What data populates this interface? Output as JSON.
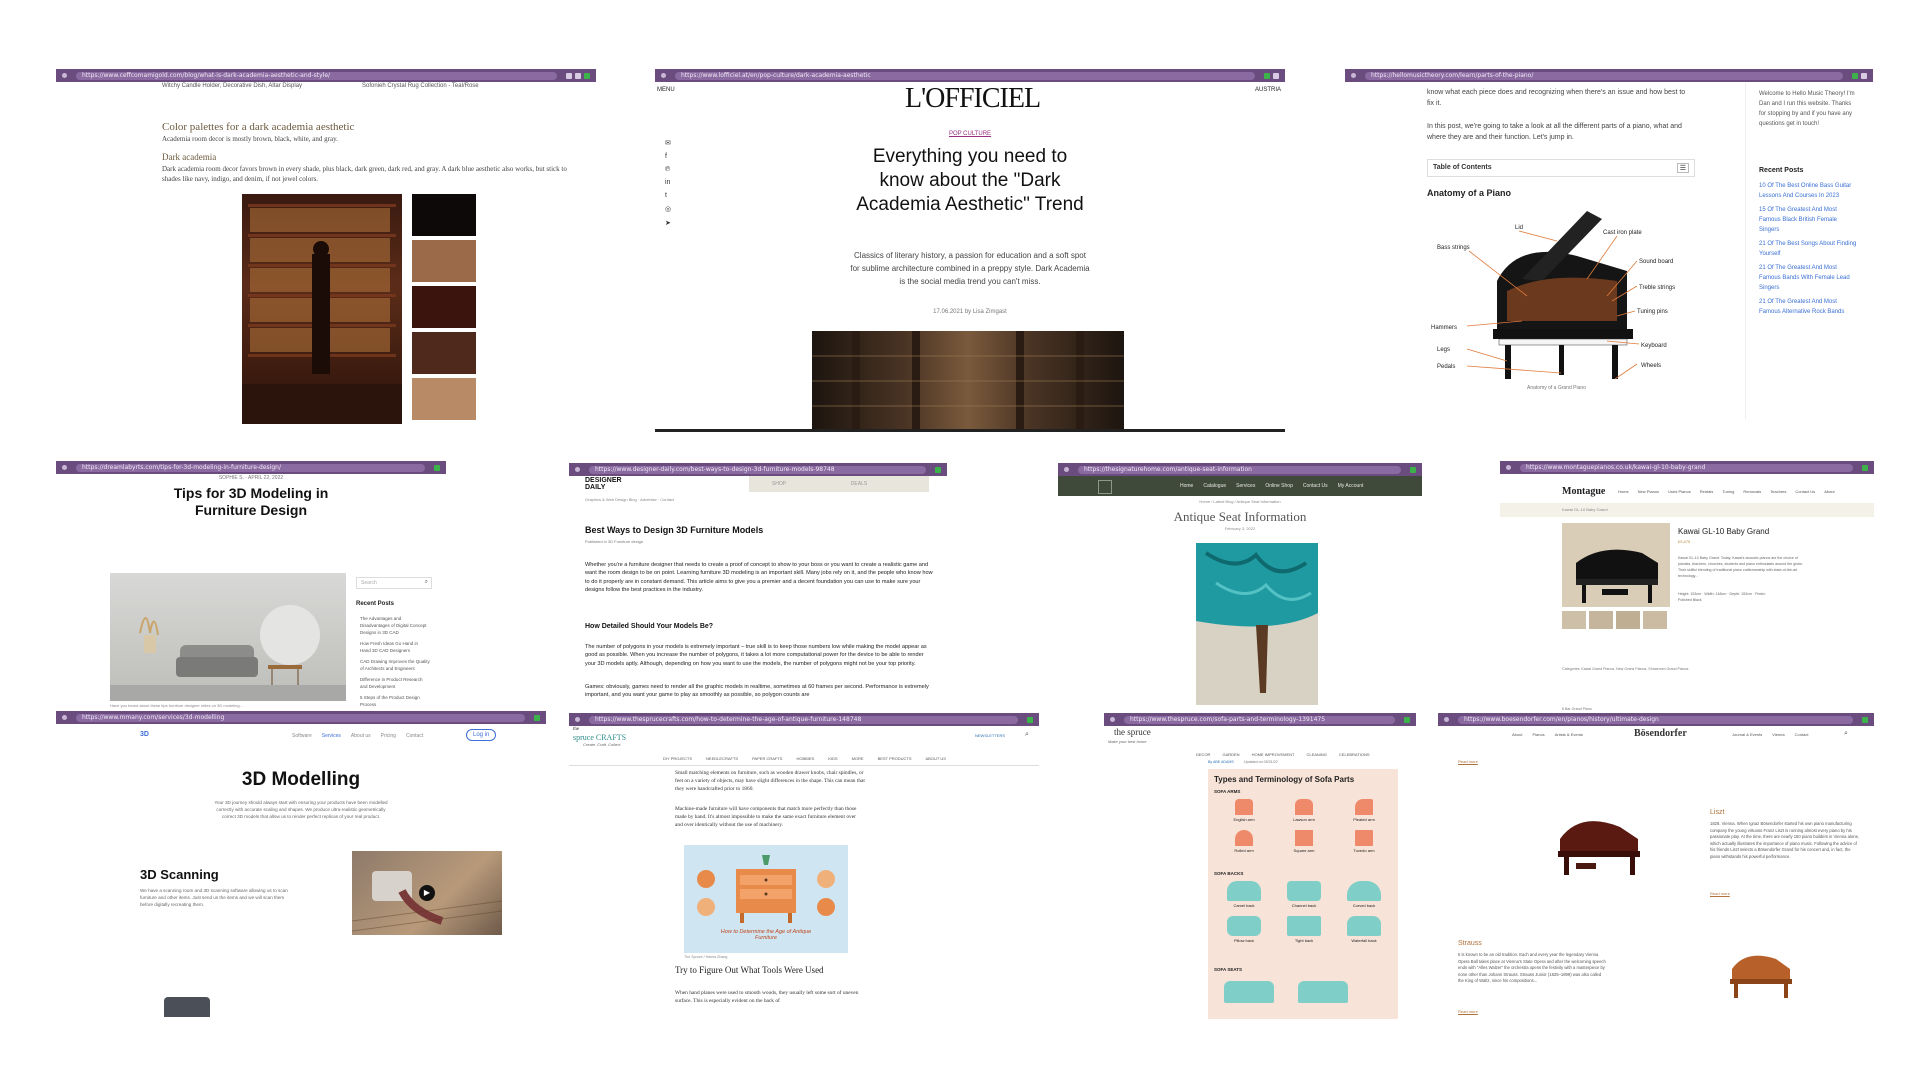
{
  "s1": {
    "url": "https://www.ceffcomamigold.com/blog/what-is-dark-academia-aesthetic-and-style/",
    "top_left": "Witchy Candle Holder, Decorative Dish, Altar Display",
    "top_right": "Sofonieh Crystal Rug Collection - Teal/Rose",
    "heading": "Color palettes for a dark academia aesthetic",
    "intro": "Academia room decor is mostly brown, black, white, and gray.",
    "subheading": "Dark academia",
    "body": "Dark academia room decor favors brown in every shade, plus black, dark green, dark red, and gray. A dark blue aesthetic also works, but stick to shades like navy, indigo, and denim, if not jewel colors.",
    "swatches": [
      "#0d0909",
      "#9b6a49",
      "#3b140d",
      "#4f2a1c",
      "#b88b66"
    ]
  },
  "s2": {
    "url": "https://www.lofficiel.at/en/pop-culture/dark-academia-aesthetic",
    "menu": "MENU",
    "logo": "L'OFFICIEL",
    "region": "AUSTRIA",
    "category": "POP CULTURE",
    "title": "Everything you need to know about the \"Dark Academia Aesthetic\" Trend",
    "dek": "Classics of literary history, a passion for education and a soft spot for sublime architecture combined in a preppy style. Dark Academia is the social media trend you can't miss.",
    "byline": "17.06.2021 by Lisa Zimgast"
  },
  "s3": {
    "url": "https://hellomusictheory.com/learn/parts-of-the-piano/",
    "p1": "know what each piece does and recognizing when there's an issue and how best to fix it.",
    "p2": "In this post, we're going to take a look at all the different parts of a piano, what and where they are and their function. Let's jump in.",
    "toc": "Table of Contents",
    "section": "Anatomy of a Piano",
    "labels": [
      "Lid",
      "Cast iron plate",
      "Bass strings",
      "Sound board",
      "Treble strings",
      "Tuning pins",
      "Hammers",
      "Keyboard",
      "Legs",
      "Pedals",
      "Wheels"
    ],
    "caption": "Anatomy of a Grand Piano",
    "sidebar_intro": "Welcome to Hello Music Theory! I'm Dan and I run this website. Thanks for stopping by and if you have any questions get in touch!",
    "recent_title": "Recent Posts",
    "recent": [
      "10 Of The Best Online Bass Guitar Lessons And Courses In 2023",
      "15 Of The Greatest And Most Famous Black British Female Singers",
      "21 Of The Best Songs About Finding Yourself",
      "21 Of The Greatest And Most Famous Bands With Female Lead Singers",
      "21 Of The Greatest And Most Famous Alternative Rock Bands"
    ]
  },
  "s4": {
    "url": "https://dreamlabyrts.com/tips-for-3d-modeling-in-furniture-design/",
    "meta": "SOPHIE S. · APRIL 22, 2022",
    "title": "Tips for 3D Modeling in Furniture Design",
    "search": "Search",
    "recent_title": "Recent Posts",
    "recent": [
      "The Advantages and Disadvantages of Digital Concept Designs in 3D CAD",
      "How Fresh Ideas Go Hand in Hand 3D CAD Designers",
      "CAD Drawing Improves the Quality of Architects and Engineers",
      "Difference in Product Research and Development",
      "5 Steps of the Product Design Process"
    ],
    "caption": "Have you heard about these tips furniture designer relies on 3D modeling..."
  },
  "s5": {
    "url": "https://www.designer-daily.com/best-ways-to-design-3d-furniture-models-98748",
    "logo_line1": "DESIGNER",
    "logo_line2": "DAILY",
    "tab1": "SHOP",
    "tab2": "DEALS",
    "crumbs": "Graphics & Web Design Blog · Advertise · Contact",
    "title": "Best Ways to Design 3D Furniture Models",
    "published": "Published in 3D Furniture design",
    "p1": "Whether you're a furniture designer that needs to create a proof of concept to show to your boss or you want to create a realistic game and want the room design to be on point. Learning furniture 3D modeling is an important skill. Many jobs rely on it, and the people who know how to do it properly are in constant demand. This article aims to give you a premier and a decent foundation you can use to make sure your designs follow the best practices in the industry.",
    "h2": "How Detailed Should Your Models Be?",
    "p2": "The number of polygons in your models is extremely important – true skill is to keep those numbers low while making the model appear as good as possible. When you increase the number of polygons, it takes a lot more computational power for the device to be able to render your 3D models aptly. Although, depending on how you want to use the models, the number of polygons might not be your top priority.",
    "p3": "Games: obviously, games need to render all the graphic models in realtime, sometimes at 60 frames per second. Performance is extremely important, and you want your game to play as smoothly as possible, so polygon counts are"
  },
  "s6": {
    "url": "https://thesignaturehome.com/antique-seat-information",
    "nav": [
      "Home",
      "Catalogue",
      "Services",
      "Online Shop",
      "Contact Us",
      "My Account"
    ],
    "crumbs": "Home / Latest Blog / Antique Seat Information",
    "title": "Antique Seat Information",
    "date": "February 3, 2022"
  },
  "s7": {
    "url": "https://www.montaguepianos.co.uk/kawai-gl-10-baby-grand",
    "logo": "Montague",
    "nav": [
      "Home",
      "New Pianos",
      "Used Pianos",
      "Rentals",
      "Tuning",
      "Removals",
      "Teachers",
      "Contact Us",
      "About"
    ],
    "crumbs": "Kawai GL-10 Baby Grand",
    "title": "Kawai GL-10 Baby Grand",
    "price": "£9,475",
    "text": "Kawai GL-10 Baby Grand. Today, Kawai's acoustic pianos are the choice of pianists, teachers, churches, students and piano enthusiasts around the globe. Their skillful blending of traditional piano craftsmanship with state-of-the-art technology...",
    "specs": "Height: 153cm · Width: 148cm · Depth: 153cm · Finish: Polished Black",
    "category": "Categories: Kawai Grand Pianos, New Grand Pianos, Showroom Grand Pianos",
    "caption": "6 Bar Grand Piano"
  },
  "s8": {
    "url": "https://www.mmany.com/services/3d-modelling",
    "brand": "3D",
    "nav": [
      "Software",
      "Services",
      "About us",
      "Pricing",
      "Contact"
    ],
    "login": "Log in",
    "title": "3D Modelling",
    "intro": "Your 3D journey should always start with ensuring your products have been modelled correctly with accurate scaling and shapes. We produce ultra-realistic geometrically correct 3D models that allow us to render perfect replicas of your real product.",
    "sub": "3D Scanning",
    "sub_text": "We have a scanning room and 3D scanning software allowing us to scan furniture and other items. Just send us the items and we will scan them before digitally recreating them."
  },
  "s9": {
    "url": "https://www.thesprucecrafts.com/how-to-determine-the-age-of-antique-furniture-148748",
    "logo_top": "the",
    "logo": "spruce CRAFTS",
    "tagline": "Create. Craft. Collect.",
    "newsletter": "NEWSLETTERS",
    "nav": [
      "DIY PROJECTS",
      "NEEDLECRAFTS",
      "PAPER CRAFTS",
      "HOBBIES",
      "KIDS",
      "MORE",
      "BEST PRODUCTS",
      "ABOUT US"
    ],
    "p1": "Small matching elements on furniture, such as wooden drawer knobs, chair spindles, or feet on a variety of objects, may have slight differences in the shape. This can mean that they were handcrafted prior to 1860.",
    "p2": "Machine-made furniture will have components that match more perfectly than those made by hand. It's almost impossible to make the same exact furniture element over and over identically without the use of machinery.",
    "infographic": "How to Determine the Age of Antique Furniture",
    "credit": "The Spruce / Hanna Zhang",
    "h2": "Try to Figure Out What Tools Were Used",
    "p3": "When hand planes were used to smooth woods, they usually left some sort of uneven surface. This is especially evident on the back of"
  },
  "s10": {
    "url": "https://www.thespruce.com/sofa-parts-and-terminology-1391475",
    "logo": "the spruce",
    "tagline": "Make your best home",
    "nav": [
      "DECOR",
      "GARDEN",
      "HOME IMPROVEMENT",
      "CLEANING",
      "CELEBRATIONS"
    ],
    "author": "By ABE ADAMS",
    "updated": "Updated on 05/31/22",
    "title": "Types and Terminology of Sofa Parts",
    "arms_title": "SOFA ARMS",
    "arms": [
      "English arm",
      "Lawson arm",
      "Pleated arm",
      "Rolled arm",
      "Square arm",
      "Tuxedo arm"
    ],
    "backs_title": "SOFA BACKS",
    "backs": [
      "Camel back",
      "Channel back",
      "Curved back",
      "Pillow back",
      "Tight back",
      "Waterfall back"
    ],
    "seats_title": "SOFA SEATS"
  },
  "s11": {
    "url": "https://www.boesendorfer.com/en/pianos/history/ultimate-design",
    "nav": [
      "About",
      "Pianos",
      "Artists & Events"
    ],
    "logo": "Bösendorfer",
    "nav2": [
      "Journal & Events",
      "Vienna",
      "Contact"
    ],
    "read_more": "Read more",
    "h_liszt": "Liszt",
    "p_liszt": "1828, Vienna. When Ignaz Bösendorfer started his own piano manufacturing company the young virtuoso Franz Liszt is running almost every piano by his passionate play. At the time, there are nearly 150 piano builders in Vienna alone, which actually illustrates the importance of piano music. Following the advice of his friends Liszt selects a Bösendorfer Grand for his concert and, in fact, the piano withstands his powerful performance.",
    "h_strauss": "Strauss",
    "p_strauss": "It is known to be an old tradition. Each and every year the legendary Vienna Opera Ball takes place at Vienna's State Opera and after the welcoming speech ends with \"Alles Walzer\" the orchestra opens the festivity with a masterpiece by none other than Johann Strauss. Strauss Junior (1825–1899) was also called the King of Waltz, since his compositions..."
  }
}
